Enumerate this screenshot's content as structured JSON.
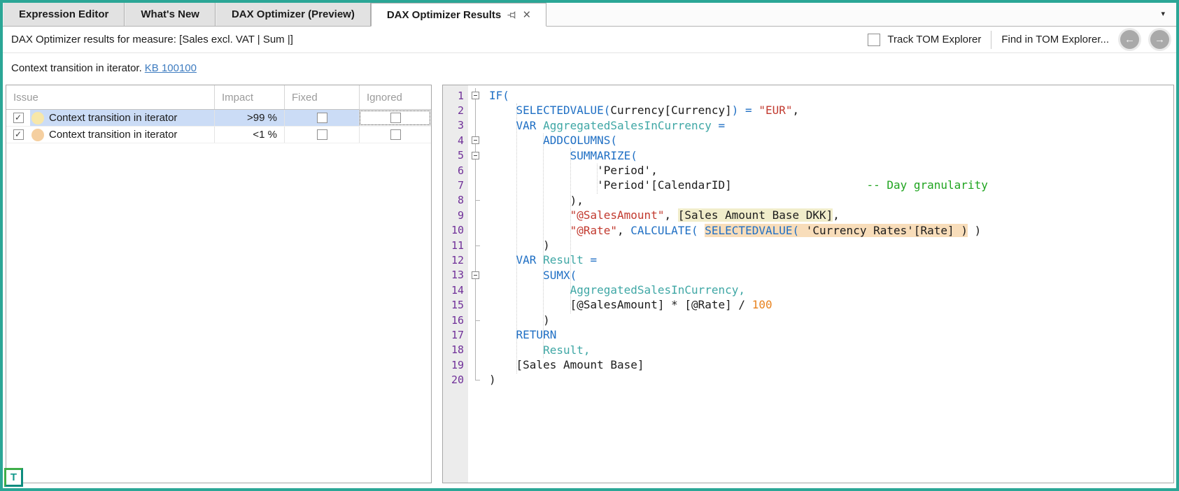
{
  "colors": {
    "accent_teal": "#2BA696",
    "selection_blue": "#CBDCF6",
    "link_blue": "#3E7CC0",
    "keyword_blue": "#1F6FC4",
    "variable_teal": "#3FA7A5",
    "string_red": "#C23A2F",
    "comment_green": "#1FA41F",
    "number_orange": "#E8821E",
    "line_number_purple": "#703099",
    "highlight_yellow": "#F1EDCB",
    "highlight_orange": "#F8DDBA"
  },
  "tabbar": {
    "tabs": [
      {
        "label": "Expression Editor"
      },
      {
        "label": "What's New"
      },
      {
        "label": "DAX Optimizer (Preview)"
      },
      {
        "label": "DAX Optimizer Results",
        "active": true
      }
    ],
    "overflow_caret": "▾",
    "close_glyph": "×"
  },
  "toolbar": {
    "results_label": "DAX Optimizer results for measure: [Sales excl. VAT | Sum |]",
    "track_tom_label": "Track TOM Explorer",
    "track_tom_checked": false,
    "find_tom_label": "Find in TOM Explorer...",
    "nav_back_icon": "←",
    "nav_forward_icon": "→"
  },
  "issue_summary": {
    "text": "Context transition in iterator.",
    "kb_link": "KB 100100"
  },
  "issues_table": {
    "columns": [
      "Issue",
      "Impact",
      "Fixed",
      "Ignored"
    ],
    "check_glyph": "✓",
    "rows": [
      {
        "enabled": true,
        "severity_color": "#F7E7A9",
        "issue": "Context transition in iterator",
        "impact": ">99 %",
        "fixed": false,
        "ignored": false,
        "selected": true,
        "focused_cell": "ignored"
      },
      {
        "enabled": true,
        "severity_color": "#F5CFA0",
        "issue": "Context transition in iterator",
        "impact": "<1 %",
        "fixed": false,
        "ignored": false,
        "selected": false
      }
    ]
  },
  "editor": {
    "lines": [
      {
        "n": 1,
        "fold": "box",
        "tokens": [
          [
            "kw",
            "IF("
          ]
        ]
      },
      {
        "n": 2,
        "fold": "v",
        "tokens": [
          [
            "txt",
            "    "
          ],
          [
            "kw",
            "SELECTEDVALUE("
          ],
          [
            "txt",
            "Currency[Currency]"
          ],
          [
            "kw",
            ") = "
          ],
          [
            "str",
            "\"EUR\""
          ],
          [
            "txt",
            ","
          ]
        ]
      },
      {
        "n": 3,
        "fold": "v",
        "tokens": [
          [
            "txt",
            "    "
          ],
          [
            "kw",
            "VAR "
          ],
          [
            "var",
            "AggregatedSalesInCurrency"
          ],
          [
            "kw",
            " ="
          ]
        ]
      },
      {
        "n": 4,
        "fold": "box",
        "tokens": [
          [
            "txt",
            "        "
          ],
          [
            "kw",
            "ADDCOLUMNS("
          ]
        ]
      },
      {
        "n": 5,
        "fold": "box",
        "tokens": [
          [
            "txt",
            "            "
          ],
          [
            "kw",
            "SUMMARIZE("
          ]
        ]
      },
      {
        "n": 6,
        "fold": "v",
        "tokens": [
          [
            "txt",
            "                'Period',"
          ]
        ]
      },
      {
        "n": 7,
        "fold": "v",
        "tokens": [
          [
            "txt",
            "                'Period'[CalendarID]"
          ],
          [
            "txt",
            "                    "
          ],
          [
            "com",
            "-- Day granularity"
          ]
        ]
      },
      {
        "n": 8,
        "fold": "end",
        "tokens": [
          [
            "txt",
            "            ),"
          ]
        ]
      },
      {
        "n": 9,
        "fold": "v",
        "tokens": [
          [
            "txt",
            "            "
          ],
          [
            "str",
            "\"@SalesAmount\""
          ],
          [
            "txt",
            ", "
          ],
          [
            "txt",
            "[Sales Amount Base DKK]",
            "y"
          ],
          [
            "txt",
            ","
          ]
        ]
      },
      {
        "n": 10,
        "fold": "v",
        "tokens": [
          [
            "txt",
            "            "
          ],
          [
            "str",
            "\"@Rate\""
          ],
          [
            "txt",
            ", "
          ],
          [
            "kw",
            "CALCULATE("
          ],
          [
            "txt",
            " "
          ],
          [
            "kw",
            "SELECTEDVALUE(",
            "o"
          ],
          [
            "txt",
            " 'Currency Rates'[Rate] )",
            "o"
          ],
          [
            "txt",
            " )"
          ]
        ]
      },
      {
        "n": 11,
        "fold": "end",
        "tokens": [
          [
            "txt",
            "        )"
          ]
        ]
      },
      {
        "n": 12,
        "fold": "v",
        "tokens": [
          [
            "txt",
            "    "
          ],
          [
            "kw",
            "VAR "
          ],
          [
            "var",
            "Result"
          ],
          [
            "kw",
            " ="
          ]
        ]
      },
      {
        "n": 13,
        "fold": "box",
        "tokens": [
          [
            "txt",
            "        "
          ],
          [
            "kw",
            "SUMX("
          ]
        ]
      },
      {
        "n": 14,
        "fold": "v",
        "tokens": [
          [
            "txt",
            "            "
          ],
          [
            "var",
            "AggregatedSalesInCurrency,"
          ]
        ]
      },
      {
        "n": 15,
        "fold": "v",
        "tokens": [
          [
            "txt",
            "            [@SalesAmount] * [@Rate] / "
          ],
          [
            "num",
            "100"
          ]
        ]
      },
      {
        "n": 16,
        "fold": "end",
        "tokens": [
          [
            "txt",
            "        )"
          ]
        ]
      },
      {
        "n": 17,
        "fold": "v",
        "tokens": [
          [
            "txt",
            "    "
          ],
          [
            "kw",
            "RETURN"
          ]
        ]
      },
      {
        "n": 18,
        "fold": "v",
        "tokens": [
          [
            "txt",
            "        "
          ],
          [
            "var",
            "Result,"
          ]
        ]
      },
      {
        "n": 19,
        "fold": "v",
        "tokens": [
          [
            "txt",
            "    [Sales Amount Base]"
          ]
        ]
      },
      {
        "n": 20,
        "fold": "endstop",
        "tokens": [
          [
            "txt",
            ")"
          ]
        ]
      }
    ]
  },
  "logo": {
    "letter": "T"
  }
}
